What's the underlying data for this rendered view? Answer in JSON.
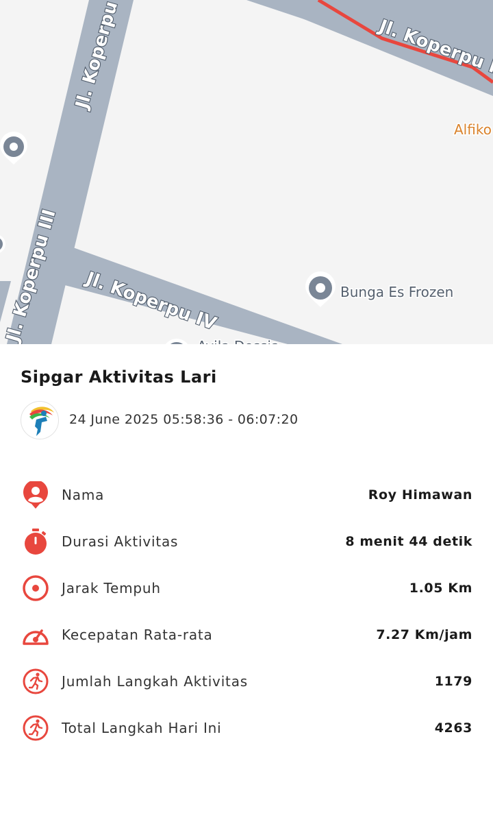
{
  "map": {
    "roads": [
      "Jl. Koperpu I",
      "Jl. Koperpu I",
      "Jl. Koperpu III",
      "Jl. Koperpu IV"
    ],
    "pois": [
      "Bunga Es Frozen",
      "Alfiko",
      "Ayila Dessia"
    ],
    "colors": {
      "road": "#a9b4c2",
      "route": "#e8473e",
      "background": "#f4f4f4"
    }
  },
  "panel": {
    "title": "Sipgar Aktivitas Lari",
    "datetime": "24 June 2025 05:58:36 - 06:07:20",
    "accent": "#e8473e",
    "stats": [
      {
        "icon": "person-pin-icon",
        "label": "Nama",
        "value": "Roy Himawan"
      },
      {
        "icon": "stopwatch-icon",
        "label": "Durasi Aktivitas",
        "value": "8 menit 44 detik"
      },
      {
        "icon": "target-icon",
        "label": "Jarak Tempuh",
        "value": "1.05 Km"
      },
      {
        "icon": "speedometer-icon",
        "label": "Kecepatan Rata-rata",
        "value": "7.27 Km/jam"
      },
      {
        "icon": "runner-icon",
        "label": "Jumlah Langkah Aktivitas",
        "value": "1179"
      },
      {
        "icon": "runner-icon",
        "label": "Total Langkah Hari Ini",
        "value": "4263"
      }
    ]
  }
}
